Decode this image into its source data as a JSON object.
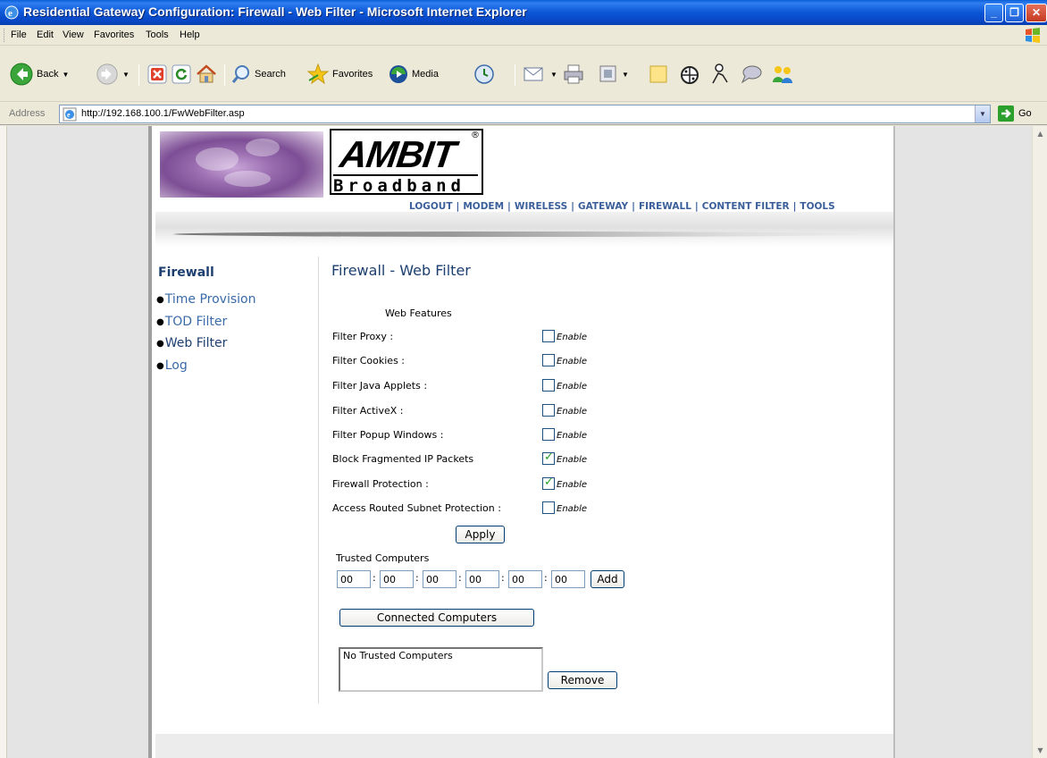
{
  "window": {
    "title": "Residential Gateway Configuration: Firewall - Web Filter - Microsoft Internet Explorer",
    "controls": [
      "minimize",
      "maximize",
      "close"
    ]
  },
  "menubar": {
    "items": [
      "File",
      "Edit",
      "View",
      "Favorites",
      "Tools",
      "Help"
    ]
  },
  "toolbar": {
    "back": "Back",
    "search": "Search",
    "favorites": "Favorites",
    "media": "Media"
  },
  "addressbar": {
    "label": "Address",
    "url": "http://192.168.100.1/FwWebFilter.asp",
    "go": "Go"
  },
  "banner": {
    "logo_text": "AMBIT",
    "logo_sub": "Broadband",
    "registered": "®"
  },
  "topnav": {
    "items": [
      "LOGOUT",
      "MODEM",
      "WIRELESS",
      "GATEWAY",
      "FIREWALL",
      "CONTENT FILTER",
      "TOOLS"
    ]
  },
  "sidebar": {
    "title": "Firewall",
    "items": [
      "Time Provision",
      "TOD Filter",
      "Web Filter",
      "Log"
    ]
  },
  "main": {
    "title": "Firewall - Web Filter",
    "section_label": "Web Features",
    "enable_label": "Enable",
    "features": [
      {
        "label": "Filter Proxy :",
        "checked": false
      },
      {
        "label": "Filter Cookies :",
        "checked": false
      },
      {
        "label": "Filter Java Applets :",
        "checked": false
      },
      {
        "label": "Filter ActiveX :",
        "checked": false
      },
      {
        "label": "Filter Popup Windows :",
        "checked": false
      },
      {
        "label": "Block Fragmented IP Packets",
        "checked": true
      },
      {
        "label": "Firewall Protection :",
        "checked": true
      },
      {
        "label": "Access Routed Subnet Protection :",
        "checked": false
      }
    ],
    "apply_label": "Apply",
    "trusted_label": "Trusted Computers",
    "mac_fields": [
      "00",
      "00",
      "00",
      "00",
      "00",
      "00"
    ],
    "add_label": "Add",
    "connected_label": "Connected Computers",
    "trusted_list": [
      "No Trusted Computers"
    ],
    "remove_label": "Remove"
  },
  "colors": {
    "title_bar": "#0b56d6",
    "nav_link": "#3a5f9a",
    "heading": "#1d3f6f",
    "sidebar_link": "#3a6aa8",
    "check": "#21a121"
  }
}
